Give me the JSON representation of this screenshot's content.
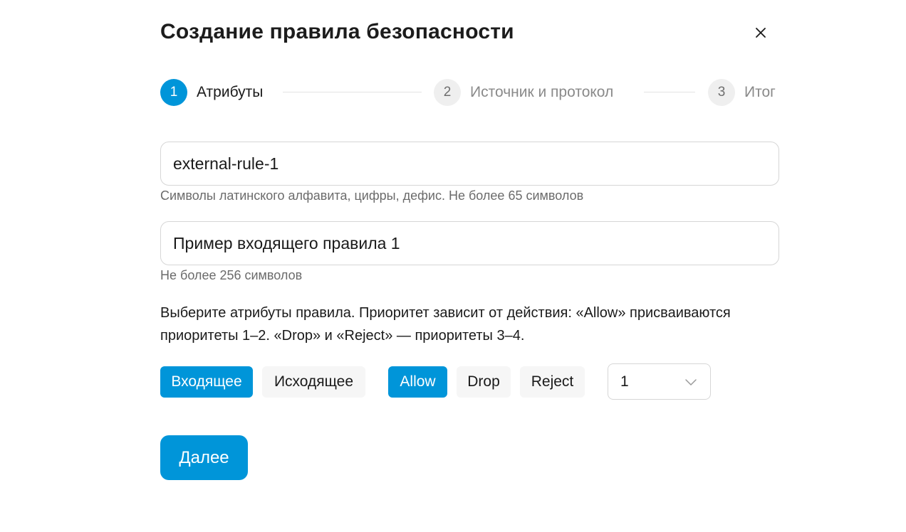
{
  "dialog": {
    "title": "Создание правила безопасности",
    "close_icon": "close-icon"
  },
  "stepper": {
    "steps": [
      {
        "number": "1",
        "label": "Атрибуты",
        "state": "active"
      },
      {
        "number": "2",
        "label": "Источник и протокол",
        "state": "inactive"
      },
      {
        "number": "3",
        "label": "Итог",
        "state": "inactive"
      }
    ]
  },
  "form": {
    "name": {
      "value": "external-rule-1",
      "hint": "Символы латинского алфавита, цифры, дефис. Не более 65 символов"
    },
    "description": {
      "value": "Пример входящего правила 1",
      "hint": "Не более 256 символов"
    },
    "info_text": "Выберите атрибуты правила. Приоритет зависит от действия: «Allow» присваиваются приоритеты 1–2. «Drop» и «Reject» — приоритеты 3–4.",
    "direction": {
      "options": [
        {
          "label": "Входящее",
          "selected": true
        },
        {
          "label": "Исходящее",
          "selected": false
        }
      ]
    },
    "action": {
      "options": [
        {
          "label": "Allow",
          "selected": true
        },
        {
          "label": "Drop",
          "selected": false
        },
        {
          "label": "Reject",
          "selected": false
        }
      ]
    },
    "priority": {
      "value": "1",
      "icon": "chevron-down-icon"
    }
  },
  "footer": {
    "next_label": "Далее"
  },
  "colors": {
    "accent": "#0095d9",
    "chip_inactive_bg": "#f6f6f6",
    "border": "#d6d6d6",
    "hint_text": "#6b6b6b"
  }
}
